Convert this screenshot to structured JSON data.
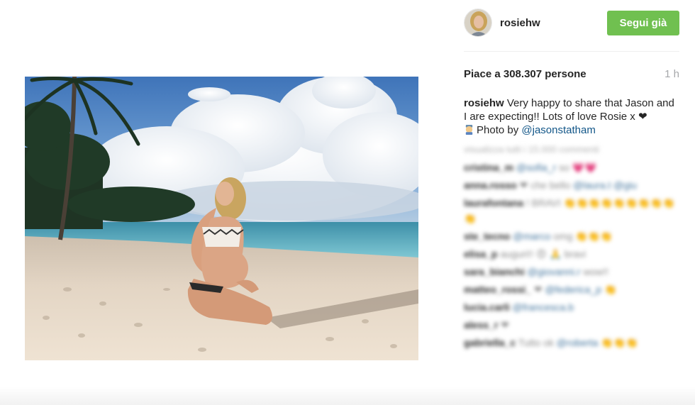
{
  "post": {
    "username": "rosiehw",
    "follow_label": "Segui già",
    "likes_text": "Piace a 308.307 persone",
    "time_text": "1 h",
    "caption_user": "rosiehw",
    "caption_text": "Very happy to share that Jason and I are expecting!! Lots of love Rosie x ❤",
    "caption_photo_by": "Photo by",
    "caption_mention": "@jasonstatham",
    "colors": {
      "follow_button": "#70c050",
      "mention": "#125688"
    }
  },
  "comments": {
    "load_more": "visualizza tutti i 15.000 commenti",
    "items": [
      {
        "user": "cristina_m",
        "mention": "@sofia_r",
        "text": "so",
        "emoji": "💗💗"
      },
      {
        "user": "anna.rosso",
        "text": "❤ che bello",
        "mention": "@laura.t",
        "extra": "@giu"
      },
      {
        "user": "laurafontana",
        "text": "! BRAVI",
        "emoji": "👏👏👏👏👏👏👏👏👏👏"
      },
      {
        "user": "ste_tecno",
        "mention": "@marco",
        "text": "omg",
        "emoji": "👏👏👏"
      },
      {
        "user": "elisa_p",
        "text": "auguri!! 😍 🙏 bravi"
      },
      {
        "user": "sara_bianchi",
        "mention": "@giovanni.r",
        "text": "wow!!"
      },
      {
        "user": "matteo_rossi_",
        "text": "❤",
        "mention": "@federica_p",
        "emoji": "👏"
      },
      {
        "user": "lucia.carli",
        "mention": "@francesca.b"
      },
      {
        "user": "aless_r",
        "text": "❤"
      },
      {
        "user": "gabriella_c",
        "text": "Tutto ok",
        "mention": "@roberta",
        "emoji": "👏👏👏"
      }
    ]
  }
}
